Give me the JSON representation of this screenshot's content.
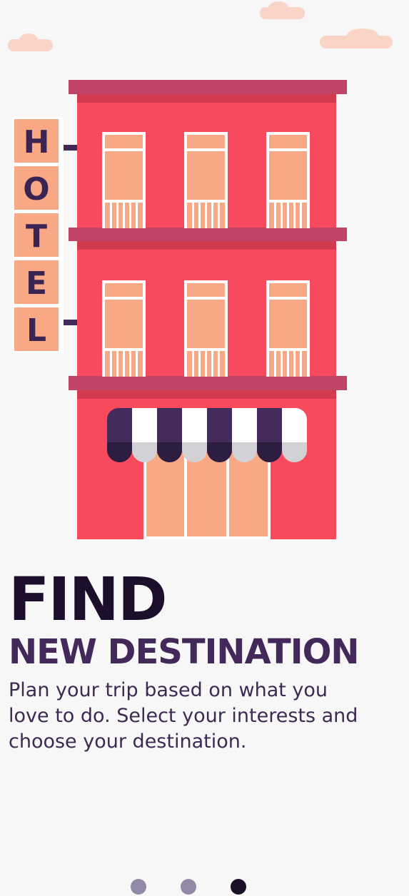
{
  "onboarding": {
    "sign_letters": [
      "H",
      "O",
      "T",
      "E",
      "L"
    ],
    "title": "FIND",
    "subtitle": "NEW DESTINATION",
    "description": "Plan your trip based on what you love to do. Select your interests and choose your destination.",
    "page_count": 3,
    "active_page": 3
  },
  "colors": {
    "background": "#f7f7f7",
    "building": "#f94a5d",
    "ledge": "#bf4466",
    "window": "#f8a884",
    "awning_dark": "#432b5b",
    "title": "#1d0f2c",
    "subtitle": "#43295a",
    "dot_inactive": "#9189a6",
    "dot_active": "#1b1127"
  },
  "icons": [
    "hotel-building-illustration",
    "cloud-icon"
  ]
}
